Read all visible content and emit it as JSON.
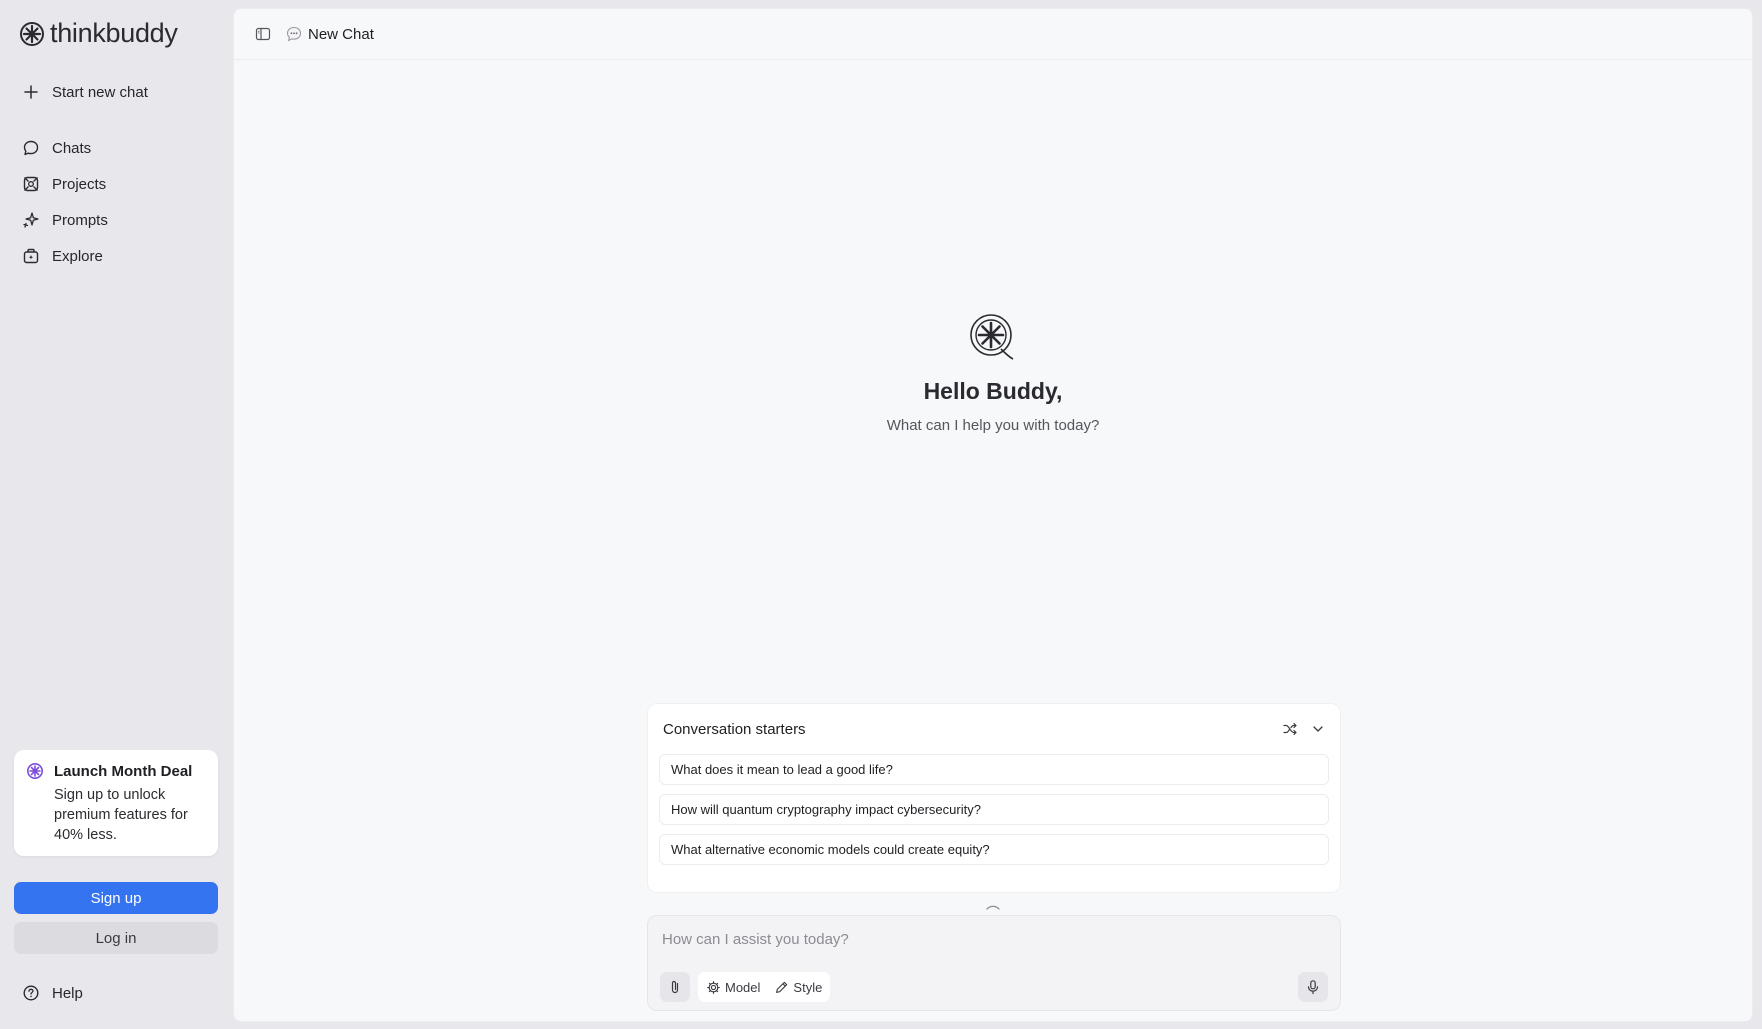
{
  "app": {
    "brand": "thinkbuddy"
  },
  "sidebar": {
    "new_chat_label": "Start new chat",
    "items": [
      {
        "label": "Chats",
        "icon": "chat-bubble-icon"
      },
      {
        "label": "Projects",
        "icon": "projects-icon"
      },
      {
        "label": "Prompts",
        "icon": "sparkles-icon"
      },
      {
        "label": "Explore",
        "icon": "explore-icon"
      }
    ],
    "promo": {
      "title": "Launch Month Deal",
      "text": "Sign up to unlock premium features for 40% less.",
      "icon": "thinkbuddy-logo-icon"
    },
    "signup_label": "Sign up",
    "login_label": "Log in",
    "help_label": "Help"
  },
  "header": {
    "title": "New Chat",
    "title_icon": "speech-bubble-icon",
    "toggle_icon": "sidebar-toggle-icon"
  },
  "hero": {
    "greeting": "Hello Buddy,",
    "subtitle": "What can I help you with today?"
  },
  "starters": {
    "title": "Conversation starters",
    "items": [
      "What does it mean to lead a good life?",
      "How will quantum cryptography impact cybersecurity?",
      "What alternative economic models could create equity?"
    ]
  },
  "composer": {
    "placeholder": "How can I assist you today?",
    "model_label": "Model",
    "style_label": "Style"
  },
  "colors": {
    "accent": "#3474f0",
    "sidebar_bg": "#e8e8ec",
    "main_bg": "#f7f8fa",
    "promo_icon": "#7c4ddb"
  }
}
